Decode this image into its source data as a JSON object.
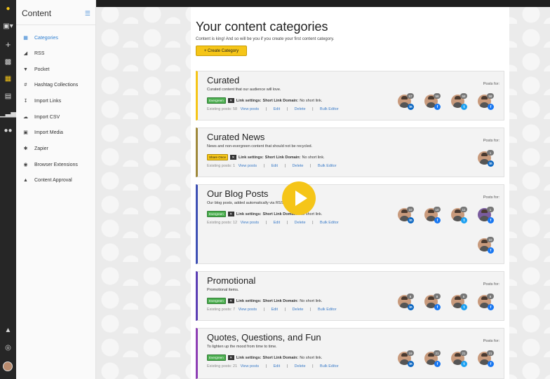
{
  "nav": {
    "title": "Content",
    "items": [
      {
        "label": "Categories",
        "icon": "grid-icon"
      },
      {
        "label": "RSS",
        "icon": "rss-icon"
      },
      {
        "label": "Pocket",
        "icon": "pocket-icon"
      },
      {
        "label": "Hashtag Collections",
        "icon": "hashtag-icon"
      },
      {
        "label": "Import Links",
        "icon": "import-icon"
      },
      {
        "label": "Import CSV",
        "icon": "cloud-upload-icon"
      },
      {
        "label": "Import Media",
        "icon": "image-icon"
      },
      {
        "label": "Zapier",
        "icon": "bolt-icon"
      },
      {
        "label": "Browser Extensions",
        "icon": "chrome-icon"
      },
      {
        "label": "Content Approval",
        "icon": "thumbs-up-icon"
      }
    ]
  },
  "page": {
    "title": "Your content categories",
    "subtitle": "Content is king! And so will be you if you create your first content category.",
    "create_button": "+ Create Category"
  },
  "labels": {
    "link_settings": "Link settings:",
    "short_link_domain": "Short Link Domain:",
    "no_short_link": "No short link.",
    "view_posts": "View posts",
    "edit": "Edit",
    "delete": "Delete",
    "bulk_editor": "Bulk Editor",
    "posts_for": "Posts for:",
    "separator": "|"
  },
  "categories": [
    {
      "title": "Curated",
      "desc": "Curated content that our audience will love.",
      "tag": "Evergreen",
      "existing": "Existing posts: 58",
      "border": "#f5c518"
    },
    {
      "title": "Curated News",
      "desc": "News and non-evergreen content that should not be recycled.",
      "tag": "Share Once",
      "existing": "Existing posts: 1",
      "border": "#a08a3c"
    },
    {
      "title": "Our Blog Posts",
      "desc": "Our blog posts, added automatically via RSS.",
      "tag": "Evergreen",
      "existing": "Existing posts: 12",
      "border": "#3f51b5"
    },
    {
      "title": "Promotional",
      "desc": "Promotional items.",
      "tag": "Evergreen",
      "existing": "Existing posts: 7",
      "border": "#5c3fb5"
    },
    {
      "title": "Quotes, Questions, and Fun",
      "desc": "To lighten up the mood from time to time.",
      "tag": "Evergreen",
      "existing": "Existing posts: 21",
      "border": "#8e3fb5"
    }
  ],
  "avatar_counts": {
    "curated": [
      "57",
      "58",
      "58",
      "58"
    ],
    "curated_news": [
      "1"
    ],
    "blog": [
      "10",
      "10",
      "11",
      "1",
      "10"
    ],
    "promo": [
      "8",
      "8",
      "6",
      "8"
    ],
    "quotes": [
      "19",
      "21",
      "21",
      "21"
    ]
  },
  "colors": {
    "accent": "#f5c518",
    "link": "#3a7bc8",
    "nav_active": "#2f7fd1"
  }
}
